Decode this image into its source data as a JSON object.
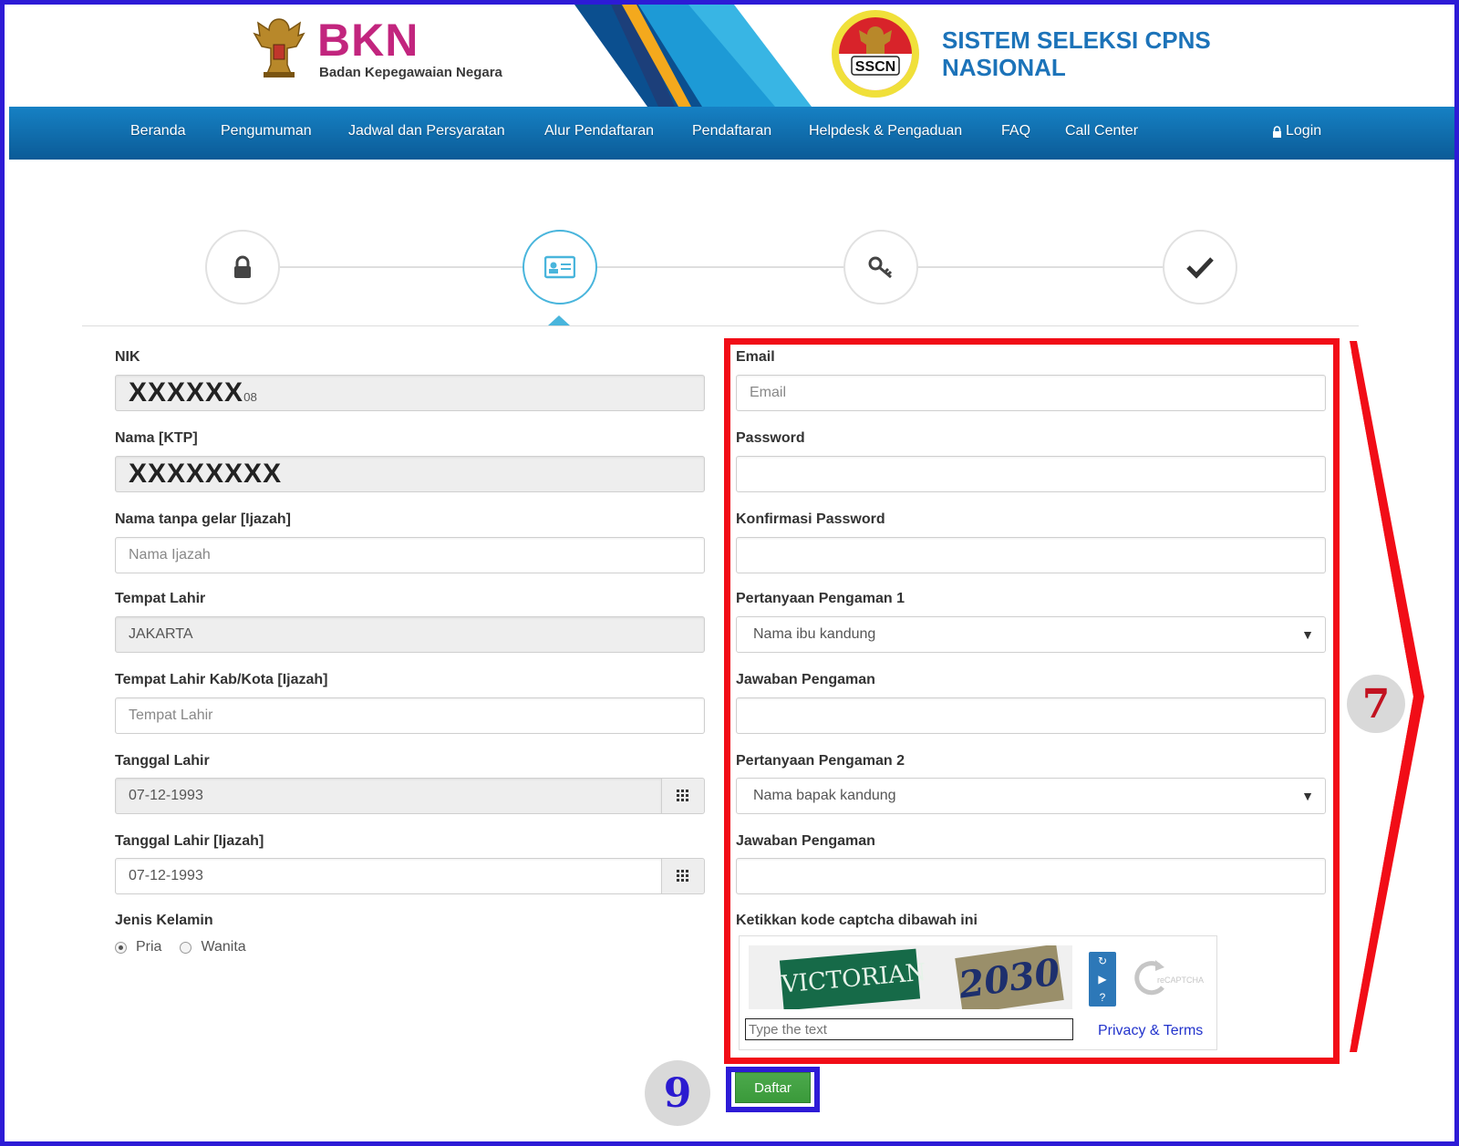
{
  "header": {
    "bkn_title": "BKN",
    "bkn_subtitle": "Badan Kepegawaian Negara",
    "sscn_badge": "SSCN",
    "sscn_title_line1": "SISTEM SELEKSI CPNS",
    "sscn_title_line2": "NASIONAL"
  },
  "nav": {
    "items": [
      "Beranda",
      "Pengumuman",
      "Jadwal dan Persyaratan",
      "Alur Pendaftaran",
      "Pendaftaran",
      "Helpdesk & Pengaduan",
      "FAQ",
      "Call Center"
    ],
    "login": "Login"
  },
  "steps": [
    {
      "icon": "lock-icon",
      "active": false
    },
    {
      "icon": "id-card-icon",
      "active": true
    },
    {
      "icon": "key-icon",
      "active": false
    },
    {
      "icon": "check-icon",
      "active": false
    }
  ],
  "colors": {
    "accent": "#49b5dc",
    "nav_top": "#1681c4",
    "nav_bottom": "#0b5b97",
    "annotation_red": "#f10d17",
    "annotation_blue": "#2d1bd6",
    "button_green": "#4ca94c"
  },
  "left_form": {
    "nik_label": "NIK",
    "nik_value_mask": "XXXXXX",
    "nik_value_tail": "08",
    "nama_label": "Nama [KTP]",
    "nama_value_mask": "XXXXXXXX",
    "nama_ijazah_label": "Nama tanpa gelar [Ijazah]",
    "nama_ijazah_placeholder": "Nama Ijazah",
    "tempat_lahir_label": "Tempat Lahir",
    "tempat_lahir_value": "JAKARTA",
    "tempat_lahir_ijazah_label": "Tempat Lahir Kab/Kota [Ijazah]",
    "tempat_lahir_ijazah_placeholder": "Tempat Lahir",
    "tanggal_lahir_label": "Tanggal Lahir",
    "tanggal_lahir_value": "07-12-1993",
    "tanggal_lahir_ijazah_label": "Tanggal Lahir [Ijazah]",
    "tanggal_lahir_ijazah_value": "07-12-1993",
    "jenis_kelamin_label": "Jenis Kelamin",
    "gender_options": [
      "Pria",
      "Wanita"
    ],
    "gender_selected": "Pria"
  },
  "right_form": {
    "email_label": "Email",
    "email_placeholder": "Email",
    "password_label": "Password",
    "konfirmasi_label": "Konfirmasi Password",
    "q1_label": "Pertanyaan Pengaman 1",
    "q1_value": "Nama ibu kandung",
    "a1_label": "Jawaban Pengaman",
    "q2_label": "Pertanyaan Pengaman 2",
    "q2_value": "Nama bapak kandung",
    "a2_label": "Jawaban Pengaman",
    "captcha_label": "Ketikkan kode captcha dibawah ini",
    "captcha_word1": "VICTORIAN",
    "captcha_word2": "2030",
    "captcha_placeholder": "Type the text",
    "captcha_privacy": "Privacy & Terms",
    "captcha_brand": "reCAPTCHA"
  },
  "submit_label": "Daftar",
  "annotations": {
    "step7": "7",
    "step9": "9"
  }
}
